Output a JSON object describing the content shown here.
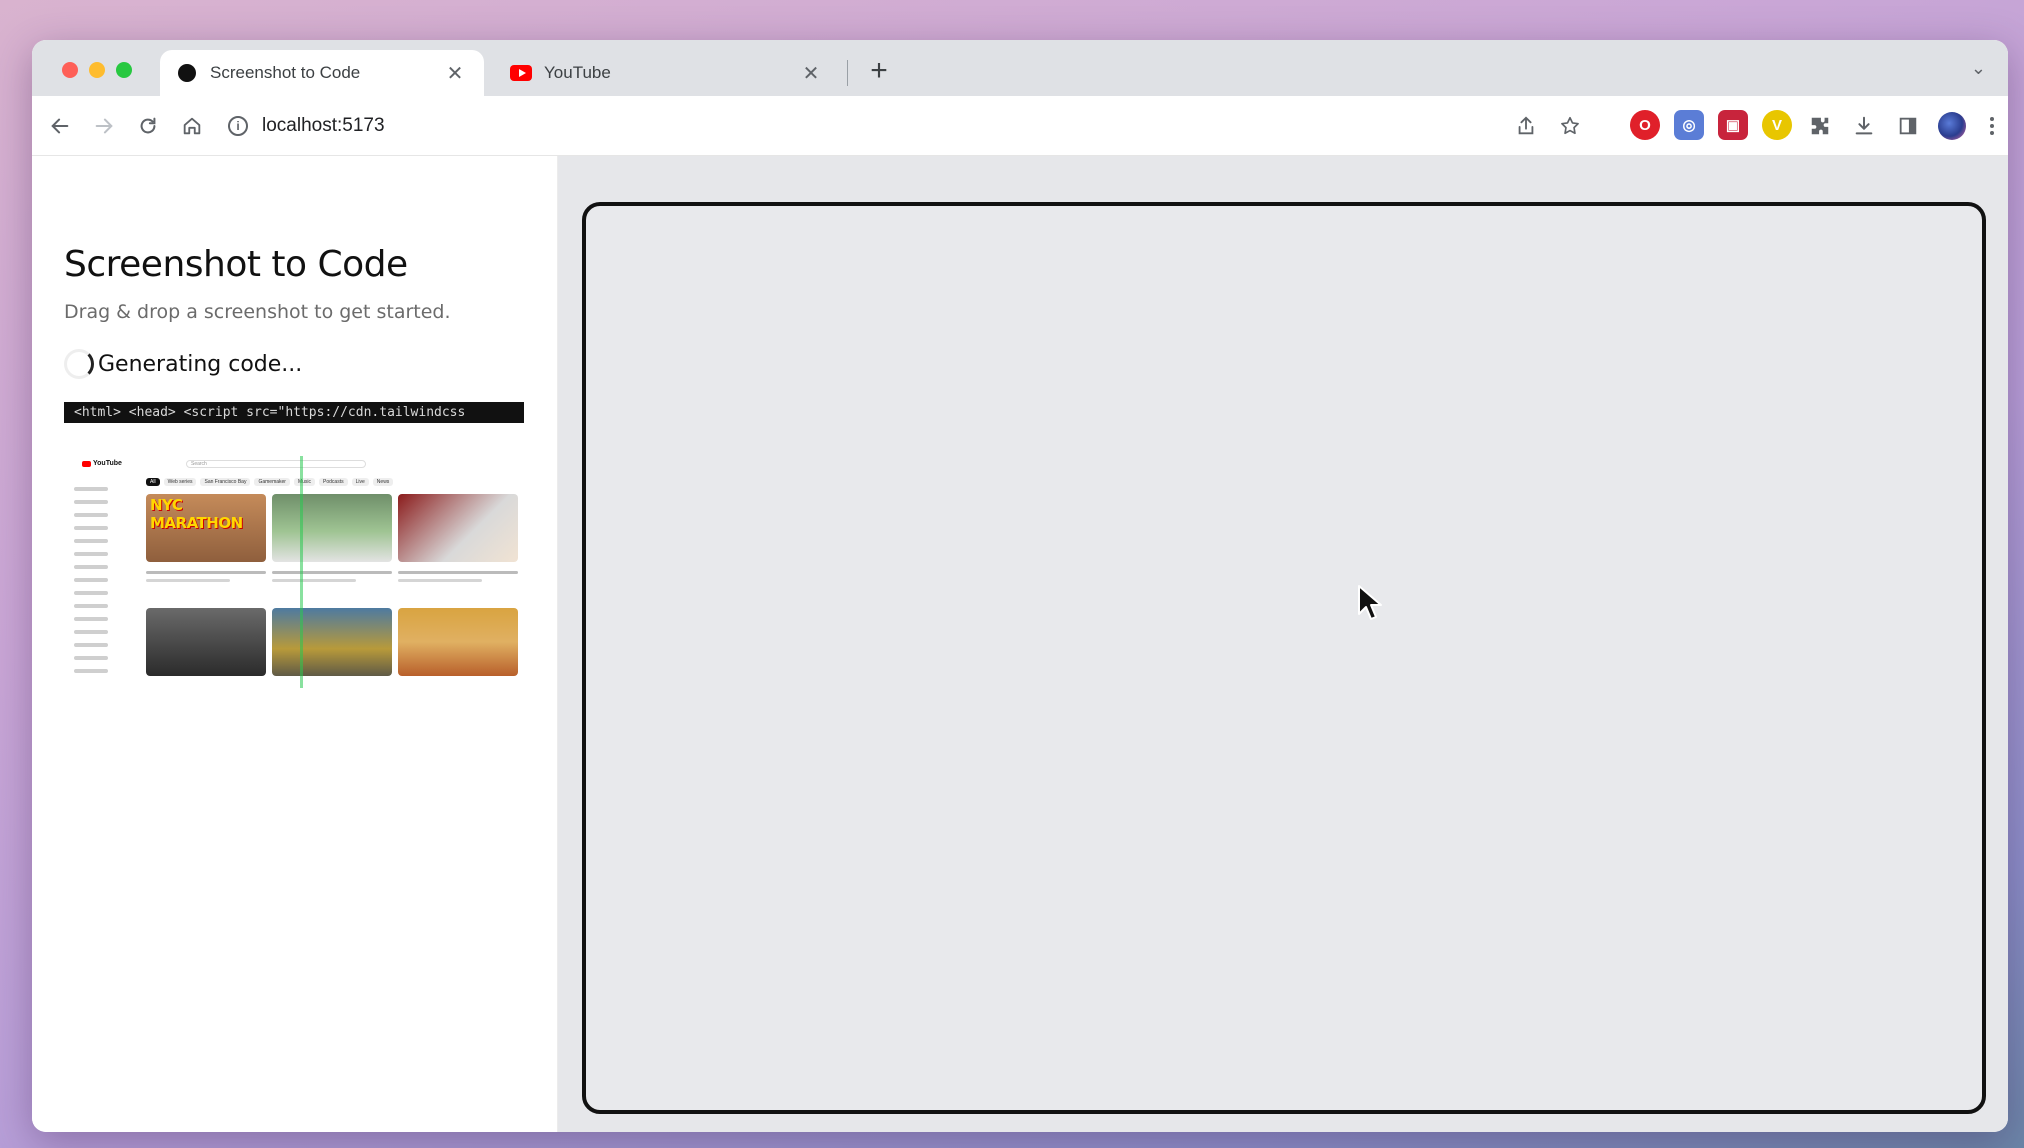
{
  "browser": {
    "tabs": [
      {
        "title": "Screenshot to Code",
        "close": "✕"
      },
      {
        "title": "YouTube",
        "close": "✕"
      }
    ],
    "new_tab": "+",
    "tab_list_dropdown": "⌄",
    "address": "localhost:5173",
    "info_icon": "i"
  },
  "extensions": [
    {
      "name": "opera-icon",
      "label": "O",
      "color": "#e0202a"
    },
    {
      "name": "privacy-extension-icon",
      "label": "◎",
      "color": "#5b7dd6"
    },
    {
      "name": "red-square-extension-icon",
      "label": "▣",
      "color": "#c8243c"
    },
    {
      "name": "v-extension-icon",
      "label": "V",
      "color": "#e8c600"
    }
  ],
  "sidebar": {
    "title": "Screenshot to Code",
    "subtitle": "Drag & drop a screenshot to get started.",
    "status": "Generating code...",
    "code_preview": "<html> <head> <script src=\"https://cdn.tailwindcss"
  },
  "thumbnail": {
    "logo": "YouTube",
    "search_placeholder": "Search",
    "chips": [
      "All",
      "Web series",
      "San Francisco Bay",
      "Gamemaker",
      "Music",
      "Podcasts",
      "Live",
      "News"
    ],
    "video_1_overlay": "NYC MARATHON"
  }
}
